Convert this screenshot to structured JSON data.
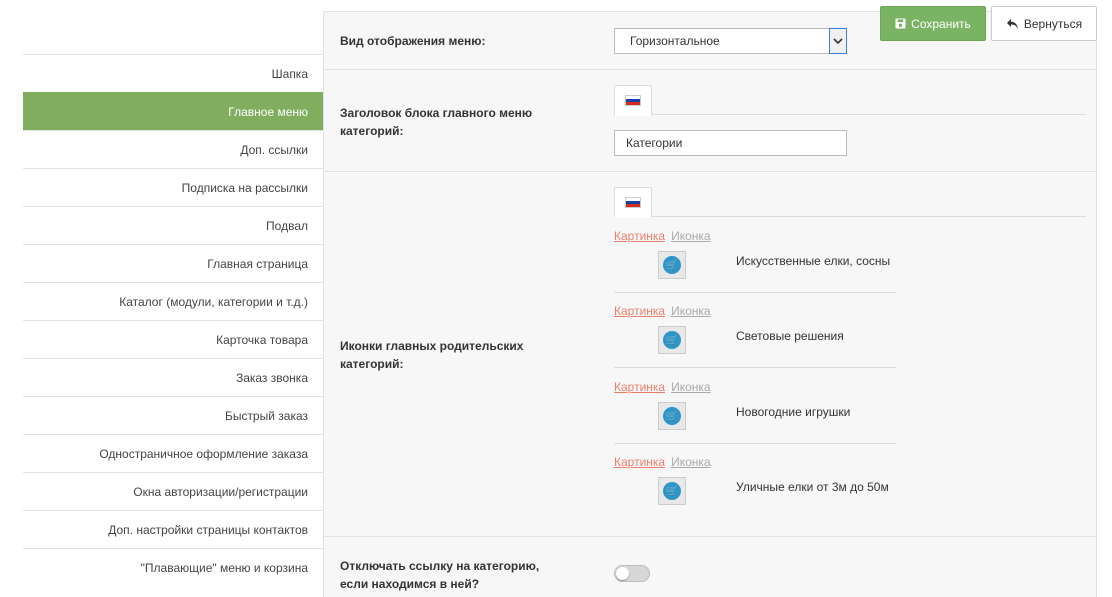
{
  "sidebar": {
    "items": [
      {
        "label": "Шапка"
      },
      {
        "label": "Главное меню"
      },
      {
        "label": "Доп. ссылки"
      },
      {
        "label": "Подписка на рассылки"
      },
      {
        "label": "Подвал"
      },
      {
        "label": "Главная страница"
      },
      {
        "label": "Каталог (модули, категории и т.д.)"
      },
      {
        "label": "Карточка товара"
      },
      {
        "label": "Заказ звонка"
      },
      {
        "label": "Быстрый заказ"
      },
      {
        "label": "Одностраничное оформление заказа"
      },
      {
        "label": "Окна авторизации/регистрации"
      },
      {
        "label": "Доп. настройки страницы контактов"
      },
      {
        "label": "\"Плавающие\" меню и корзина"
      }
    ],
    "active_index": 1,
    "active_color": "#80ad5e"
  },
  "header": {
    "save_label": "Сохранить",
    "save_icon": "floppy-disk-icon",
    "back_label": "Вернуться",
    "back_icon": "undo-arrow-icon"
  },
  "settings": {
    "menu_view": {
      "label": "Вид отображения меню:",
      "value": "Горизонтальное"
    },
    "block_title": {
      "label": "Заголовок блока главного меню категорий:",
      "language_flag": "russia-flag-icon",
      "value": "Категории"
    },
    "parent_icons": {
      "label": "Иконки главных родительских категорий:",
      "language_flag": "russia-flag-icon",
      "link_picture": "Картинка",
      "link_icon": "Иконка",
      "items": [
        {
          "name": "Искусственные елки, сосны"
        },
        {
          "name": "Световые решения"
        },
        {
          "name": "Новогодние игрушки"
        },
        {
          "name": "Уличные елки от 3м до 50м"
        }
      ]
    },
    "disable_link": {
      "label": "Отключать ссылку на категорию, если находимся в ней?",
      "enabled": false
    }
  }
}
